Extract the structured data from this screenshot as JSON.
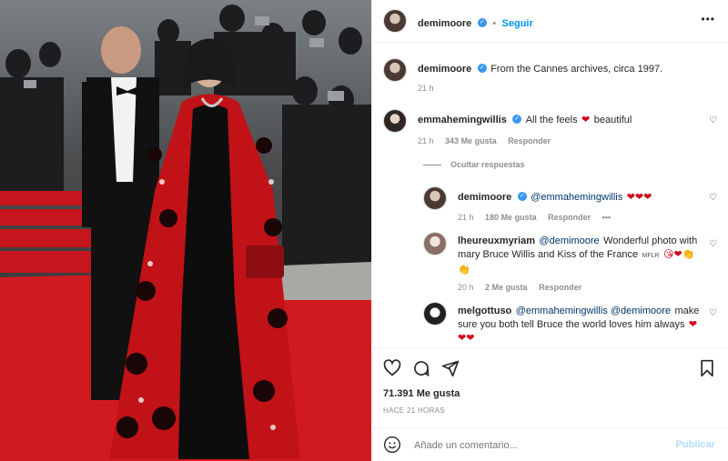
{
  "post": {
    "author": "demimoore",
    "follow_label": "Seguir",
    "more_label": "•••",
    "caption": "From the Cannes archives, circa 1997.",
    "caption_time": "21 h"
  },
  "comments": [
    {
      "user": "emmahemingwillis",
      "text": "All the feels",
      "emoji": "❤",
      "text2": "beautiful",
      "time": "21 h",
      "likes": "343 Me gusta",
      "reply": "Responder"
    },
    {
      "hide_replies": "Ocultar respuestas"
    }
  ],
  "replies": [
    {
      "user": "demimoore",
      "mention": "@emmahemingwillis",
      "emoji": "❤❤❤",
      "time": "21 h",
      "likes": "180 Me gusta",
      "reply": "Responder",
      "more": "•••"
    },
    {
      "user": "lheureuxmyriam",
      "mention": "@demimoore",
      "text": "Wonderful photo with mary Bruce Willis and Kiss of the France",
      "small": "MFLR",
      "emoji": "😘❤👏",
      "emoji2": "👏",
      "time": "20 h",
      "likes": "2 Me gusta",
      "reply": "Responder"
    },
    {
      "user": "melgottuso",
      "mention": "@emmahemingwillis @demimoore",
      "text": "make sure you both tell Bruce the world loves him always",
      "emoji": "❤❤❤"
    }
  ],
  "stats": {
    "likes": "71.391 Me gusta",
    "time": "HACE 21 HORAS"
  },
  "composer": {
    "placeholder": "Añade un comentario...",
    "publish": "Publicar"
  },
  "icons": {
    "like": "heart-icon",
    "comment": "comment-icon",
    "share": "share-icon",
    "save": "bookmark-icon",
    "emoji": "emoji-icon"
  }
}
